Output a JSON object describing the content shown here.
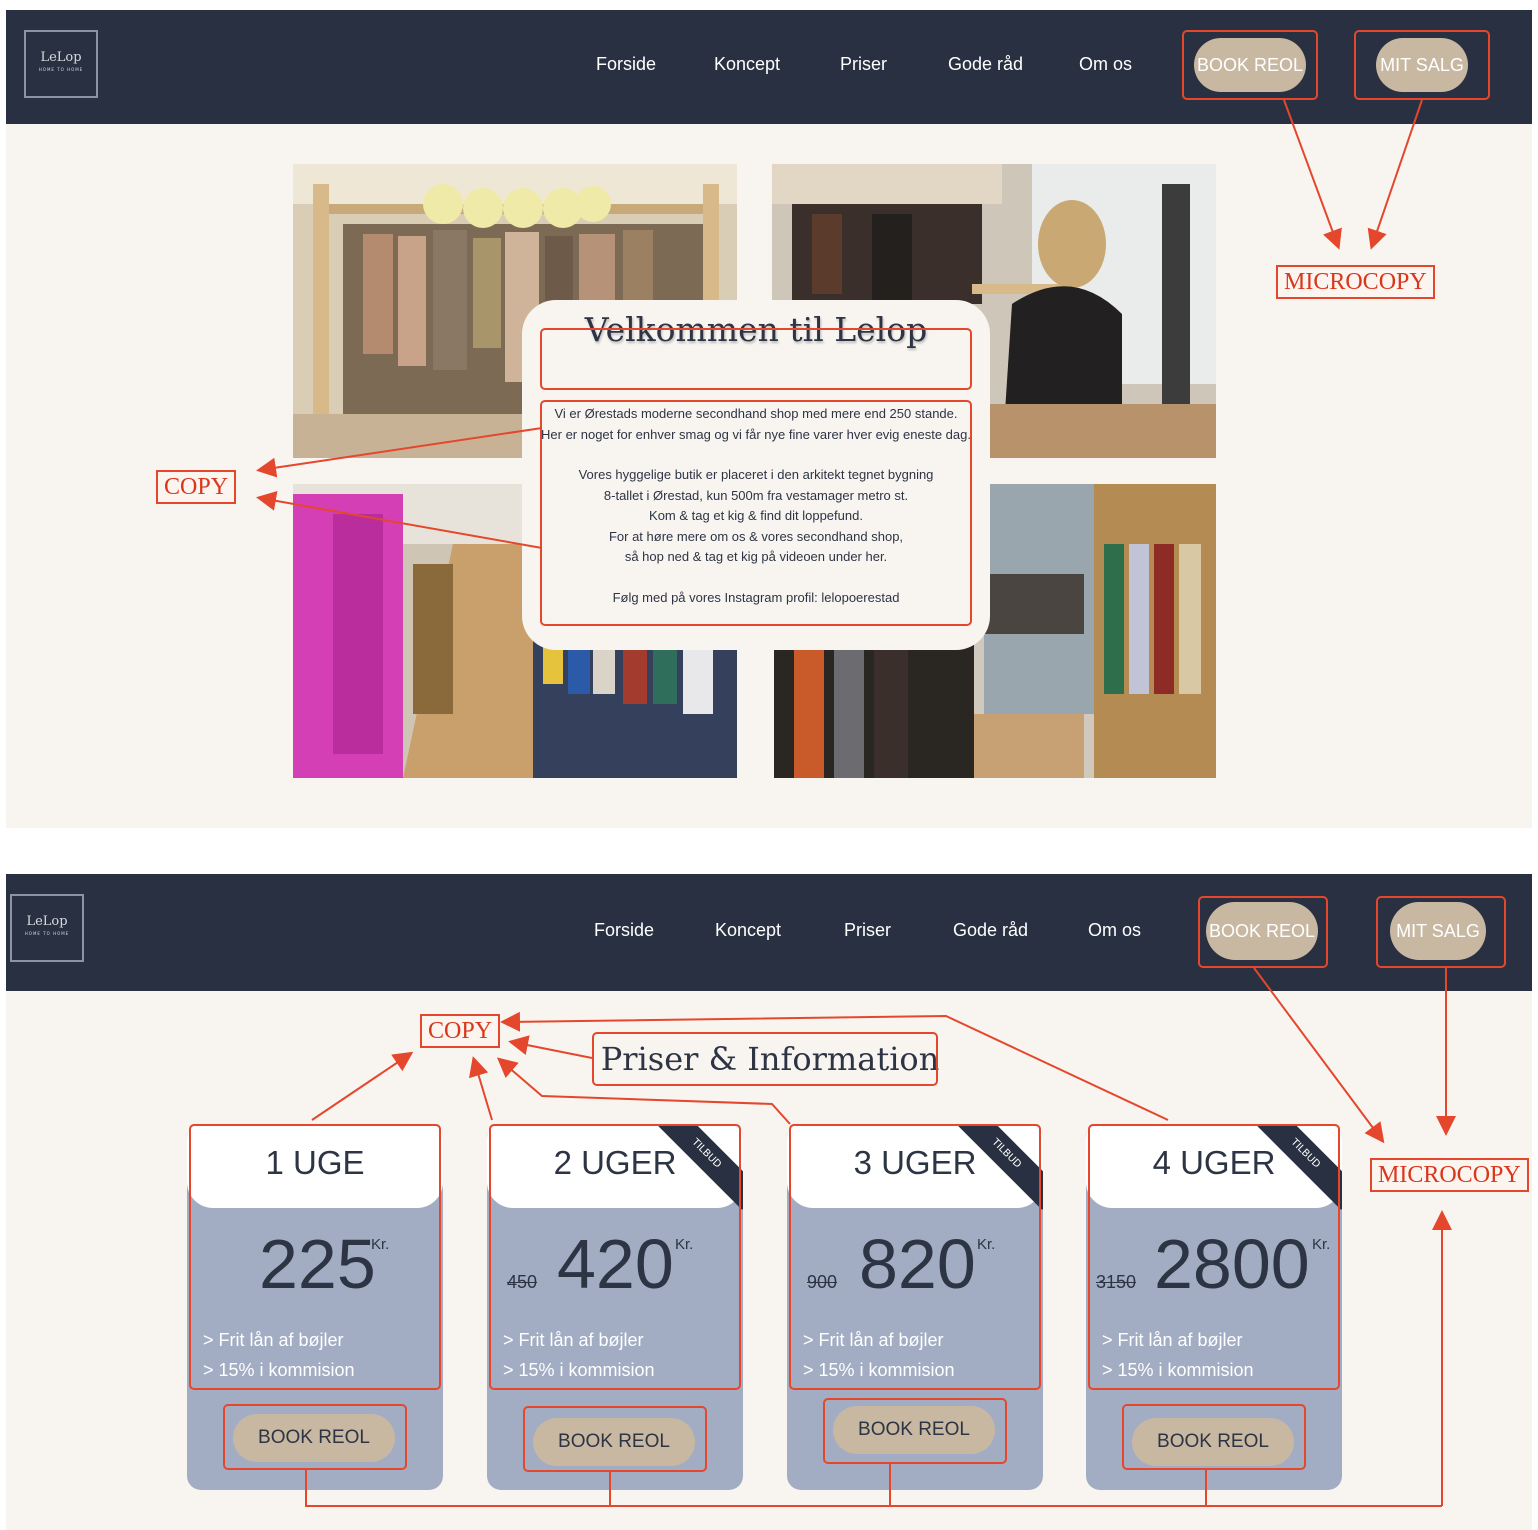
{
  "nav": {
    "logo_text": "LeLop",
    "logo_sub": "HOME TO HOME",
    "links": [
      "Forside",
      "Koncept",
      "Priser",
      "Gode råd",
      "Om os"
    ],
    "book_button": "BOOK REOL",
    "sale_button": "MIT SALG"
  },
  "welcome": {
    "title": "Velkommen til Lelop",
    "line1": "Vi er Ørestads moderne secondhand shop med mere end 250 stande.",
    "line2": "Her er noget for enhver smag og vi får nye fine varer hver evig eneste dag.",
    "line3": "Vores hyggelige butik er placeret i den arkitekt tegnet bygning",
    "line4": "8-tallet i Ørestad, kun 500m fra vestamager metro st.",
    "line5": "Kom & tag et kig & find dit loppefund.",
    "line6": "For at høre mere om os & vores secondhand shop,",
    "line7": "så hop ned & tag et kig på videoen under her.",
    "line8": "Følg med på vores Instagram profil: lelopoerestad"
  },
  "pricing": {
    "title": "Priser & Information",
    "currency": "Kr.",
    "ribbon": "TILBUD",
    "feature1": "> Frit lån af bøjler",
    "feature2": "> 15% i kommision",
    "cta": "BOOK REOL",
    "plans": [
      {
        "name": "1 UGE",
        "price": "225",
        "old_price": ""
      },
      {
        "name": "2 UGER",
        "price": "420",
        "old_price": "450"
      },
      {
        "name": "3 UGER",
        "price": "820",
        "old_price": "900"
      },
      {
        "name": "4 UGER",
        "price": "2800",
        "old_price": "3150"
      }
    ]
  },
  "annotations": {
    "microcopy": "MICROCOPY",
    "copy": "COPY"
  },
  "colors": {
    "nav_bg": "#283041",
    "accent_tan": "#c8b8a2",
    "annotation_red": "#e4472c",
    "card_blue": "#a2adc4",
    "page_bg": "#f8f5f1"
  }
}
